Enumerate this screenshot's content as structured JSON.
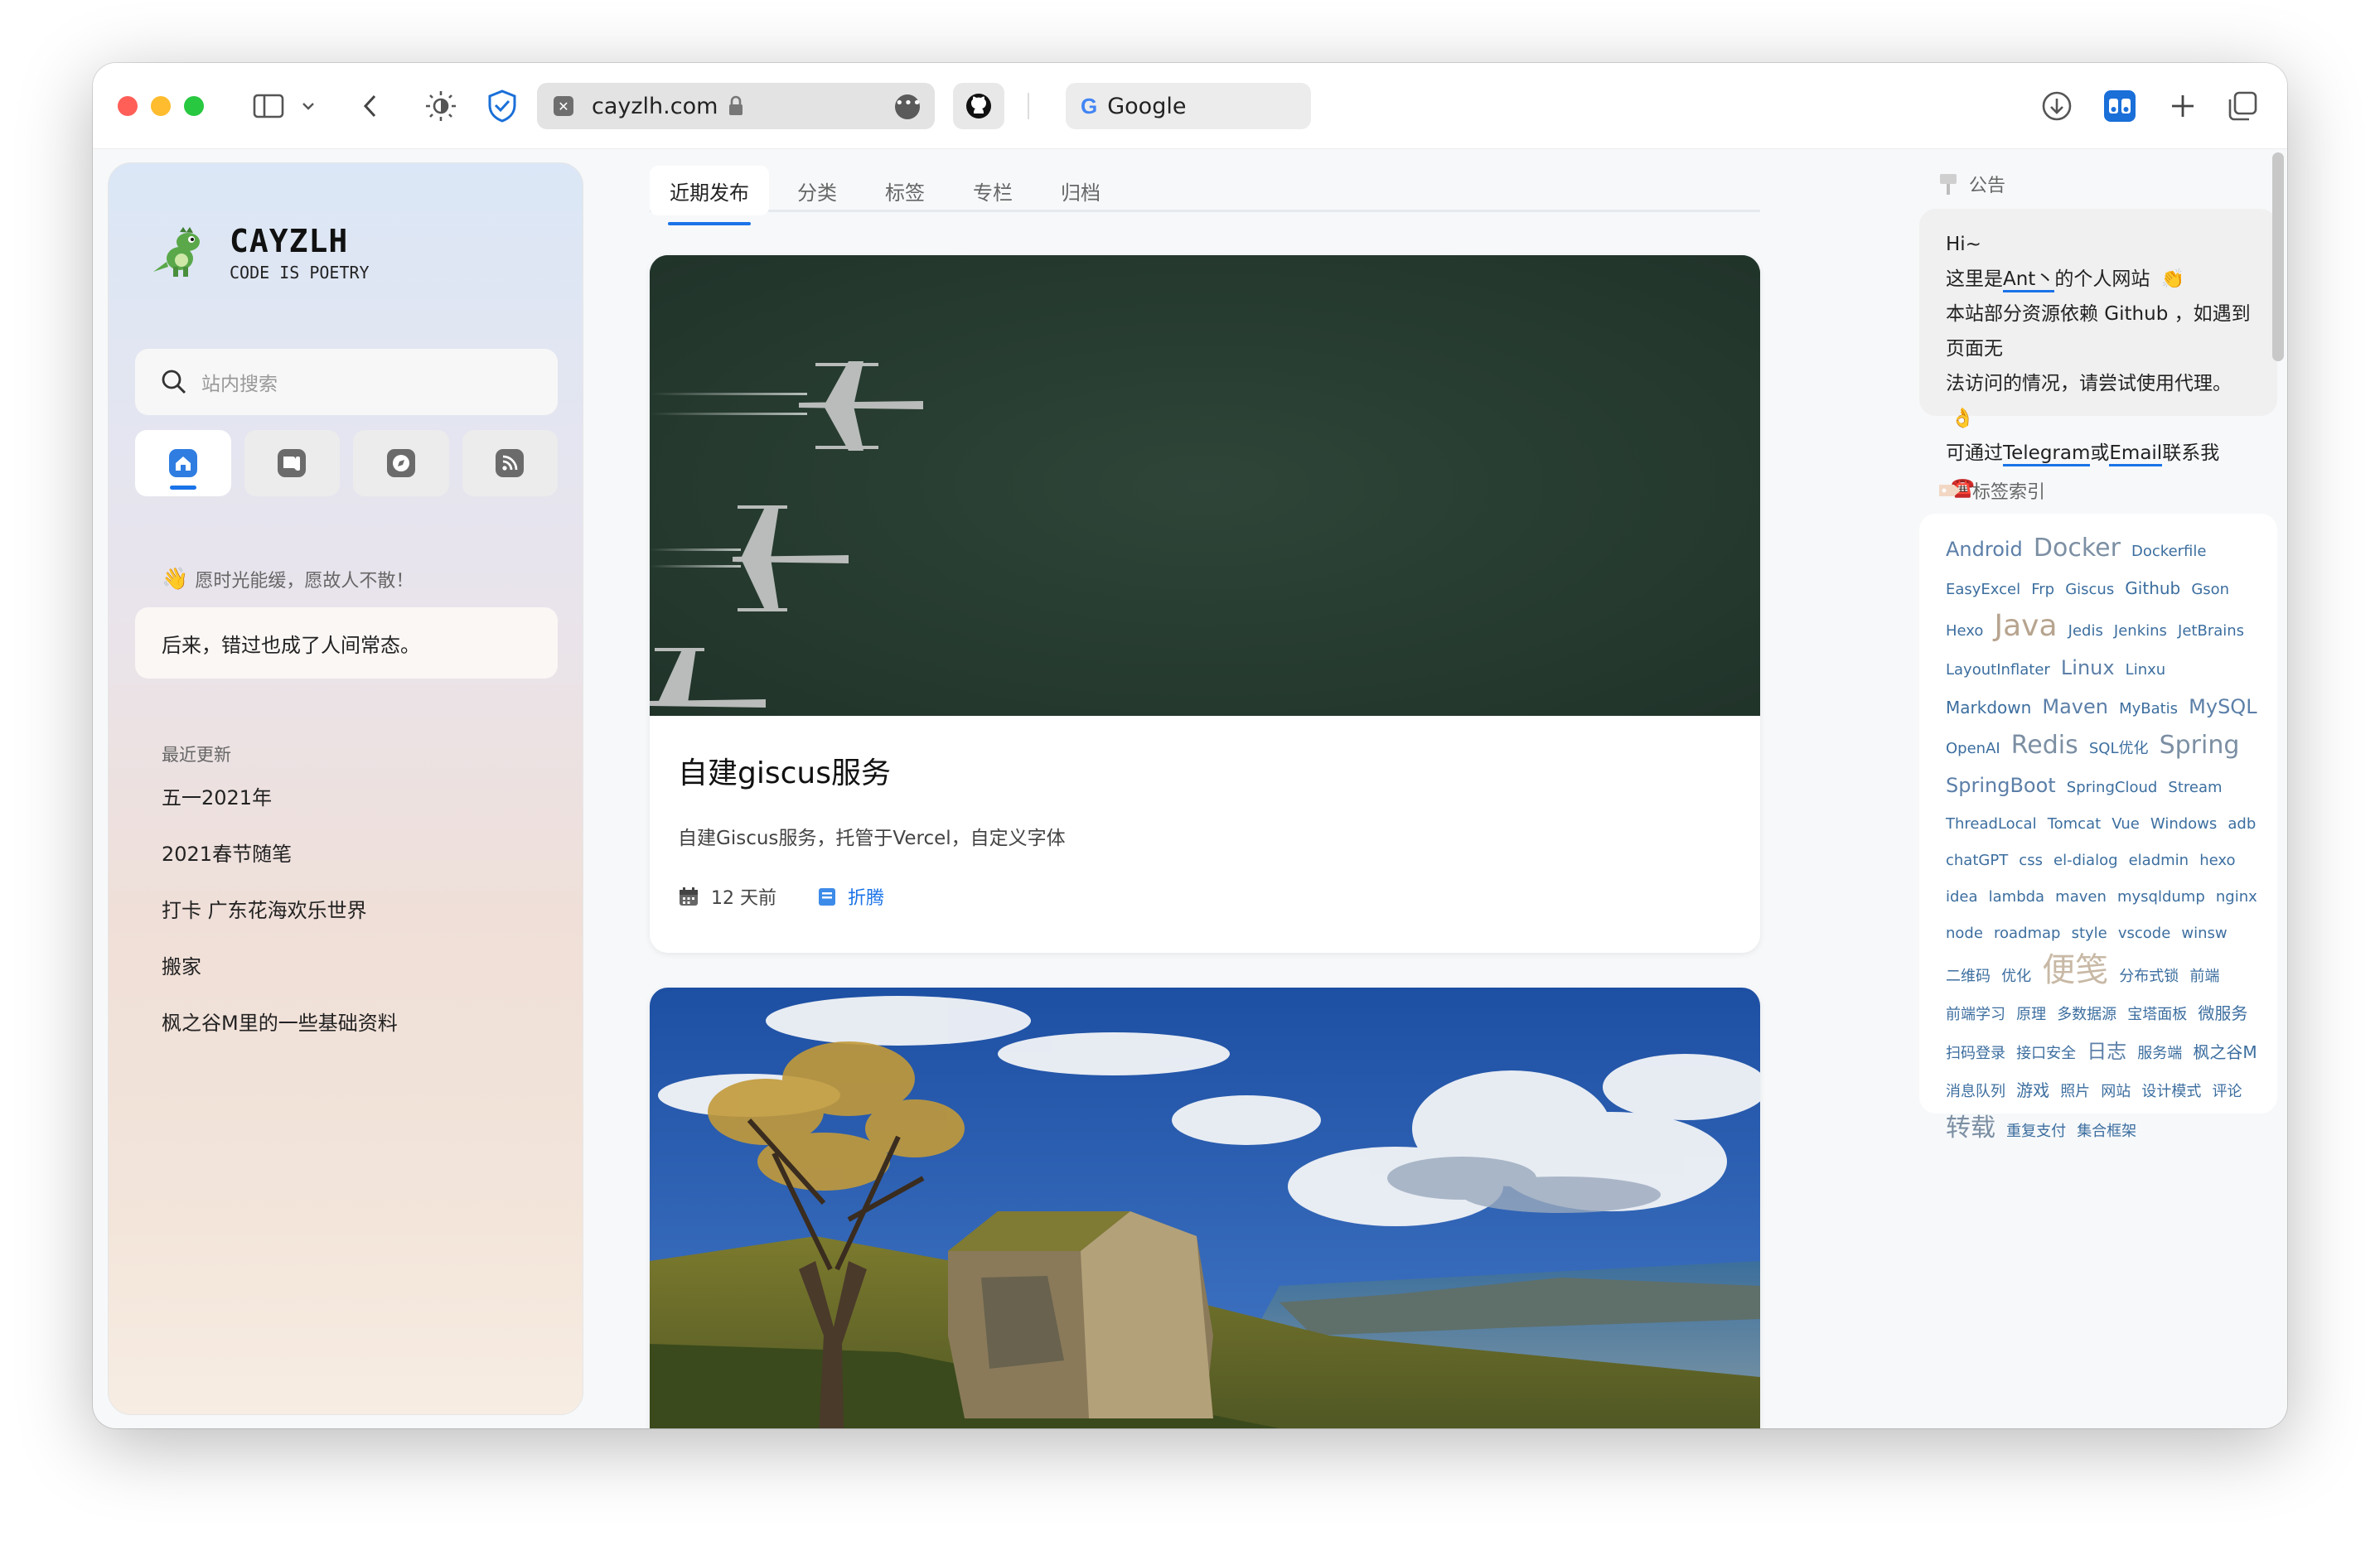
{
  "browser": {
    "address_url": "cayzlh.com",
    "second_tab": {
      "favicon": "G",
      "title": "Google"
    }
  },
  "sidebar": {
    "brand_name": "CAYZLH",
    "brand_tagline": "CODE IS POETRY",
    "search_placeholder": "站内搜索",
    "nav": [
      {
        "name": "home",
        "icon": "home-icon"
      },
      {
        "name": "book",
        "icon": "book-icon"
      },
      {
        "name": "compass",
        "icon": "compass-icon"
      },
      {
        "name": "rss",
        "icon": "rss-icon"
      }
    ],
    "motto": "愿时光能缓，愿故人不散！",
    "quote": "后来，错过也成了人间常态。",
    "recent_heading": "最近更新",
    "recent": [
      "五一2021年",
      "2021春节随笔",
      "打卡 广东花海欢乐世界",
      "搬家",
      "枫之谷M里的一些基础资料"
    ]
  },
  "main": {
    "tabs": [
      "近期发布",
      "分类",
      "标签",
      "专栏",
      "归档"
    ],
    "active_tab": "近期发布",
    "post1": {
      "title": "自建giscus服务",
      "description": "自建Giscus服务，托管于Vercel，自定义字体",
      "date": "12 天前",
      "category": "折腾"
    }
  },
  "right": {
    "notice_heading": "公告",
    "notice": {
      "greeting": "Hi~",
      "line2_pre": "这里是",
      "line2_link": "Ant丶",
      "line2_post": "的个人网站",
      "line3": "本站部分资源依赖 Github ，如遇到页面无",
      "line4": "法访问的情况，请尝试使用代理。",
      "line5_pre": "可通过",
      "line5_link1": "Telegram",
      "line5_mid": "或",
      "line5_link2": "Email",
      "line5_post": "联系我"
    },
    "tags_heading": "标签索引",
    "tags": [
      {
        "t": "Android",
        "s": "m"
      },
      {
        "t": "Docker",
        "s": "l"
      },
      {
        "t": "Dockerfile",
        "s": "s"
      },
      {
        "t": "EasyExcel",
        "s": "s"
      },
      {
        "t": "Frp",
        "s": "s"
      },
      {
        "t": "Giscus",
        "s": "s"
      },
      {
        "t": "Github",
        "s": "n"
      },
      {
        "t": "Gson",
        "s": "s"
      },
      {
        "t": "Hexo",
        "s": "s"
      },
      {
        "t": "Java",
        "s": "xl"
      },
      {
        "t": "Jedis",
        "s": "s"
      },
      {
        "t": "Jenkins",
        "s": "s"
      },
      {
        "t": "JetBrains",
        "s": "s"
      },
      {
        "t": "LayoutInflater",
        "s": "s"
      },
      {
        "t": "Linux",
        "s": "m"
      },
      {
        "t": "Linxu",
        "s": "s"
      },
      {
        "t": "Markdown",
        "s": "n"
      },
      {
        "t": "Maven",
        "s": "m"
      },
      {
        "t": "MyBatis",
        "s": "s"
      },
      {
        "t": "MySQL",
        "s": "m"
      },
      {
        "t": "OpenAI",
        "s": "s"
      },
      {
        "t": "Redis",
        "s": "l"
      },
      {
        "t": "SQL优化",
        "s": "s"
      },
      {
        "t": "Spring",
        "s": "l"
      },
      {
        "t": "SpringBoot",
        "s": "m"
      },
      {
        "t": "SpringCloud",
        "s": "s"
      },
      {
        "t": "Stream",
        "s": "s"
      },
      {
        "t": "ThreadLocal",
        "s": "s"
      },
      {
        "t": "Tomcat",
        "s": "s"
      },
      {
        "t": "Vue",
        "s": "s"
      },
      {
        "t": "Windows",
        "s": "s"
      },
      {
        "t": "adb",
        "s": "s"
      },
      {
        "t": "chatGPT",
        "s": "s"
      },
      {
        "t": "css",
        "s": "s"
      },
      {
        "t": "el-dialog",
        "s": "s"
      },
      {
        "t": "eladmin",
        "s": "s"
      },
      {
        "t": "hexo",
        "s": "s"
      },
      {
        "t": "idea",
        "s": "s"
      },
      {
        "t": "lambda",
        "s": "s"
      },
      {
        "t": "maven",
        "s": "s"
      },
      {
        "t": "mysqldump",
        "s": "s"
      },
      {
        "t": "nginx",
        "s": "s"
      },
      {
        "t": "node",
        "s": "s"
      },
      {
        "t": "roadmap",
        "s": "s"
      },
      {
        "t": "style",
        "s": "s"
      },
      {
        "t": "vscode",
        "s": "s"
      },
      {
        "t": "winsw",
        "s": "s"
      },
      {
        "t": "二维码",
        "s": "s"
      },
      {
        "t": "优化",
        "s": "s"
      },
      {
        "t": "便笺",
        "s": "xxl"
      },
      {
        "t": "分布式锁",
        "s": "s"
      },
      {
        "t": "前端",
        "s": "s"
      },
      {
        "t": "前端学习",
        "s": "s"
      },
      {
        "t": "原理",
        "s": "s"
      },
      {
        "t": "多数据源",
        "s": "s"
      },
      {
        "t": "宝塔面板",
        "s": "s"
      },
      {
        "t": "微服务",
        "s": "n"
      },
      {
        "t": "扫码登录",
        "s": "s"
      },
      {
        "t": "接口安全",
        "s": "s"
      },
      {
        "t": "日志",
        "s": "m"
      },
      {
        "t": "服务端",
        "s": "s"
      },
      {
        "t": "枫之谷M",
        "s": "n"
      },
      {
        "t": "消息队列",
        "s": "s"
      },
      {
        "t": "游戏",
        "s": "n"
      },
      {
        "t": "照片",
        "s": "s"
      },
      {
        "t": "网站",
        "s": "s"
      },
      {
        "t": "设计模式",
        "s": "s"
      },
      {
        "t": "评论",
        "s": "s"
      },
      {
        "t": "转载",
        "s": "l"
      },
      {
        "t": "重复支付",
        "s": "s"
      },
      {
        "t": "集合框架",
        "s": "s"
      }
    ]
  },
  "colors": {
    "accent": "#1a73e8",
    "tag_text": "#3c6e9f"
  }
}
